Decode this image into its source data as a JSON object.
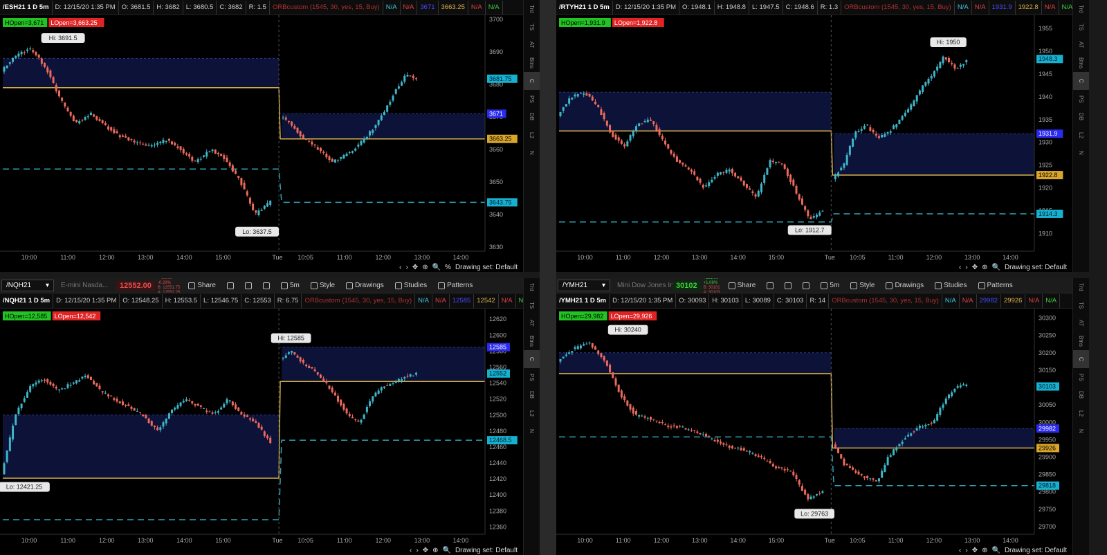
{
  "colors": {
    "up": "#3fb5c8",
    "down": "#ec6a5c",
    "zone": "#0c1238",
    "orline": "#d9b14a",
    "dash": "#2fa3b8"
  },
  "side_tabs": [
    "Trd",
    "TS",
    "AT",
    "Btns",
    "C",
    "PS",
    "DB",
    "L2",
    "N"
  ],
  "bottom": {
    "drawing_set": "Drawing set: Default",
    "percent": "%"
  },
  "toolbar_labels": {
    "share": "Share",
    "style": "Style",
    "drawings": "Drawings",
    "studies": "Studies",
    "patterns": "Patterns",
    "interval": "5m"
  },
  "panels": [
    {
      "header": {
        "symbol": "/ESH21 1 D 5m",
        "date": "D: 12/15/20 1:35 PM",
        "open": "O: 3681.5",
        "high": "H: 3682",
        "low": "L: 3680.5",
        "close": "C: 3682",
        "range": "R: 1.5",
        "study": "ORBcustom (1545, 30, yes, 15, Buy)",
        "na1": "N/A",
        "na2": "N/A",
        "val1": "3671",
        "val2": "3663.25",
        "na3": "N/A",
        "na4": "N/A"
      },
      "or_high_label": "HOpen=3,671",
      "or_low_label": "LOpen=3,663.25",
      "yticks": [
        "3700",
        "3690",
        "3680",
        "3670",
        "3660",
        "3650",
        "3640",
        "3630"
      ],
      "ymin": 3630,
      "ymax": 3700,
      "xticks": [
        "10:00",
        "11:00",
        "12:00",
        "13:00",
        "14:00",
        "15:00",
        "Tue",
        "10:05",
        "11:00",
        "12:00",
        "13:00",
        "14:00"
      ],
      "hi_label": "Hi: 3691.5",
      "lo_label": "Lo: 3637.5",
      "hi": 3691.5,
      "lo": 3637.5,
      "flags": [
        {
          "text": "3681.75",
          "v": 3681.75,
          "bg": "#16b0d0",
          "fg": "#002030"
        },
        {
          "text": "3671",
          "v": 3671,
          "bg": "#2a2af0",
          "fg": "#ffffff"
        },
        {
          "text": "3663.25",
          "v": 3663.25,
          "bg": "#d9a62a",
          "fg": "#000000"
        },
        {
          "text": "3643.75",
          "v": 3643.75,
          "bg": "#16b0d0",
          "fg": "#002030"
        }
      ],
      "day1": {
        "zoneTop": 3688,
        "zoneBot": 3679,
        "orLine": 3679,
        "dash": 3654
      },
      "day2": {
        "zoneTop": 3671,
        "zoneBot": 3663.25,
        "orLine": 3663.25,
        "dash": 3643.75
      },
      "path1": [
        3684,
        3689,
        3691,
        3685,
        3675,
        3668,
        3671,
        3667,
        3664,
        3662,
        3661,
        3663,
        3660,
        3656,
        3660,
        3657,
        3650,
        3640,
        3644
      ],
      "path2": [
        3670,
        3668,
        3664,
        3662,
        3659,
        3656,
        3658,
        3660,
        3663,
        3667,
        3672,
        3678,
        3683,
        3682
      ]
    },
    {
      "header": {
        "symbol": "/RTYH21 1 D 5m",
        "date": "D: 12/15/20 1:35 PM",
        "open": "O: 1948.1",
        "high": "H: 1948.8",
        "low": "L: 1947.5",
        "close": "C: 1948.6",
        "range": "R: 1.3",
        "study": "ORBcustom (1545, 30, yes, 15, Buy)",
        "na1": "N/A",
        "na2": "N/A",
        "val1": "1931.9",
        "val2": "1922.8",
        "na3": "N/A",
        "na4": "N/A"
      },
      "or_high_label": "HOpen=1,931.9",
      "or_low_label": "LOpen=1,922.8",
      "yticks": [
        "1955",
        "1950",
        "1945",
        "1940",
        "1935",
        "1930",
        "1925",
        "1920",
        "1915",
        "1910"
      ],
      "ymin": 1907,
      "ymax": 1957,
      "xticks": [
        "10:00",
        "11:00",
        "12:00",
        "13:00",
        "14:00",
        "15:00",
        "Tue",
        "10:05",
        "11:00",
        "12:00",
        "13:00",
        "14:00"
      ],
      "hi_label": "Hi: 1950",
      "lo_label": "Lo: 1912.7",
      "hi": 1950,
      "lo": 1912.7,
      "flags": [
        {
          "text": "1948.3",
          "v": 1948.3,
          "bg": "#16b0d0",
          "fg": "#002030"
        },
        {
          "text": "1931.9",
          "v": 1931.9,
          "bg": "#2a2af0",
          "fg": "#ffffff"
        },
        {
          "text": "1922.8",
          "v": 1922.8,
          "bg": "#d9a62a",
          "fg": "#000000"
        },
        {
          "text": "1914.3",
          "v": 1914.3,
          "bg": "#16b0d0",
          "fg": "#002030"
        }
      ],
      "day1": {
        "zoneTop": 1941,
        "zoneBot": 1932.5,
        "orLine": 1932.5,
        "dash": 1912.5
      },
      "day2": {
        "zoneTop": 1931.9,
        "zoneBot": 1922.8,
        "orLine": 1922.8,
        "dash": 1914.3
      },
      "path1": [
        1936,
        1940,
        1941,
        1938,
        1932,
        1929,
        1934,
        1935,
        1930,
        1926,
        1924,
        1920,
        1923,
        1924,
        1921,
        1918,
        1926,
        1925,
        1919,
        1913,
        1915
      ],
      "path2": [
        1922,
        1925,
        1932,
        1934,
        1931,
        1932,
        1935,
        1938,
        1942,
        1945,
        1949,
        1946,
        1948
      ]
    },
    {
      "toolbar": {
        "symbol": "/NQH21",
        "desc": "E-mini Nasda...",
        "price": "12552.00",
        "price_bg": "#3a1414",
        "price_fg": "#e05050",
        "mini": [
          "+-36.00",
          "-0.29%",
          "B: 12551.75",
          "A: 12552.25"
        ]
      },
      "header": {
        "symbol": "/NQH21 1 D 5m",
        "date": "D: 12/15/20 1:35 PM",
        "open": "O: 12548.25",
        "high": "H: 12553.5",
        "low": "L: 12546.75",
        "close": "C: 12553",
        "range": "R: 6.75",
        "study": "ORBcustom (1545, 30, yes, 15, Buy)",
        "na1": "N/A",
        "na2": "N/A",
        "val1": "12585",
        "val2": "12542",
        "na3": "N/A",
        "na4": "N/A"
      },
      "or_high_label": "HOpen=12,585",
      "or_low_label": "LOpen=12,542",
      "yticks": [
        "12620",
        "12600",
        "12580",
        "12560",
        "12540",
        "12520",
        "12500",
        "12480",
        "12460",
        "12440",
        "12420",
        "12400",
        "12380",
        "12360"
      ],
      "ymin": 12356,
      "ymax": 12628,
      "xticks": [
        "10:00",
        "11:00",
        "12:00",
        "13:00",
        "14:00",
        "15:00",
        "Tue",
        "10:05",
        "11:00",
        "12:00",
        "13:00",
        "14:00"
      ],
      "hi_label": "Hi: 12585",
      "lo_label": "Lo: 12421.25",
      "hi": 12585,
      "lo": 12421.25,
      "flags": [
        {
          "text": "12585",
          "v": 12585,
          "bg": "#2a2af0",
          "fg": "#ffffff"
        },
        {
          "text": "12552",
          "v": 12552,
          "bg": "#16b0d0",
          "fg": "#002030"
        },
        {
          "text": "12468.5",
          "v": 12468.5,
          "bg": "#16b0d0",
          "fg": "#002030"
        }
      ],
      "day1": {
        "zoneTop": 12500,
        "zoneBot": 12421,
        "orLine": 12421,
        "dash": 12369
      },
      "day2": {
        "zoneTop": 12585,
        "zoneBot": 12542,
        "orLine": 12542,
        "dash": 12468.5
      },
      "path1": [
        12425,
        12500,
        12535,
        12545,
        12530,
        12540,
        12550,
        12530,
        12520,
        12510,
        12500,
        12480,
        12505,
        12520,
        12510,
        12500,
        12520,
        12500,
        12490,
        12465
      ],
      "path2": [
        12570,
        12580,
        12565,
        12555,
        12540,
        12520,
        12500,
        12490,
        12520,
        12535,
        12540,
        12548,
        12552
      ]
    },
    {
      "toolbar": {
        "symbol": "/YMH21",
        "desc": "Mini Dow Jones In...",
        "price": "30102",
        "price_bg": "#0f2a10",
        "price_fg": "#3ccf3c",
        "mini": [
          "+321.00",
          "+1.08%",
          "B: 30101",
          "A: 30103"
        ]
      },
      "header": {
        "symbol": "/YMH21 1 D 5m",
        "date": "D: 12/15/20 1:35 PM",
        "open": "O: 30093",
        "high": "H: 30103",
        "low": "L: 30089",
        "close": "C: 30103",
        "range": "R: 14",
        "study": "ORBcustom (1545, 30, yes, 15, Buy)",
        "na1": "N/A",
        "na2": "N/A",
        "val1": "29982",
        "val2": "29926",
        "na3": "N/A",
        "na4": "N/A"
      },
      "or_high_label": "HOpen=29,982",
      "or_low_label": "LOpen=29,926",
      "yticks": [
        "30300",
        "30250",
        "30200",
        "30150",
        "30100",
        "30050",
        "30000",
        "29950",
        "29900",
        "29850",
        "29800",
        "29750",
        "29700"
      ],
      "ymin": 29690,
      "ymax": 30315,
      "xticks": [
        "10:00",
        "11:00",
        "12:00",
        "13:00",
        "14:00",
        "15:00",
        "Tue",
        "10:05",
        "11:00",
        "12:00",
        "13:00",
        "14:00"
      ],
      "hi_label": "Hi: 30240",
      "lo_label": "Lo: 29763",
      "hi": 30240,
      "lo": 29763,
      "flags": [
        {
          "text": "30103",
          "v": 30103,
          "bg": "#16b0d0",
          "fg": "#002030"
        },
        {
          "text": "29982",
          "v": 29982,
          "bg": "#2a2af0",
          "fg": "#ffffff"
        },
        {
          "text": "29926",
          "v": 29926,
          "bg": "#d9a62a",
          "fg": "#000000"
        },
        {
          "text": "29818",
          "v": 29818,
          "bg": "#16b0d0",
          "fg": "#002030"
        }
      ],
      "day1": {
        "zoneTop": 30200,
        "zoneBot": 30140,
        "orLine": 30140,
        "dash": 29958
      },
      "day2": {
        "zoneTop": 29982,
        "zoneBot": 29926,
        "orLine": 29926,
        "dash": 29818
      },
      "path1": [
        30175,
        30210,
        30230,
        30180,
        30080,
        30020,
        30010,
        29990,
        29985,
        29970,
        29950,
        29930,
        29920,
        29900,
        29870,
        29860,
        29780,
        29800
      ],
      "path2": [
        29940,
        29880,
        29860,
        29840,
        29830,
        29900,
        29940,
        29970,
        29990,
        30000,
        30060,
        30100,
        30110
      ]
    }
  ]
}
